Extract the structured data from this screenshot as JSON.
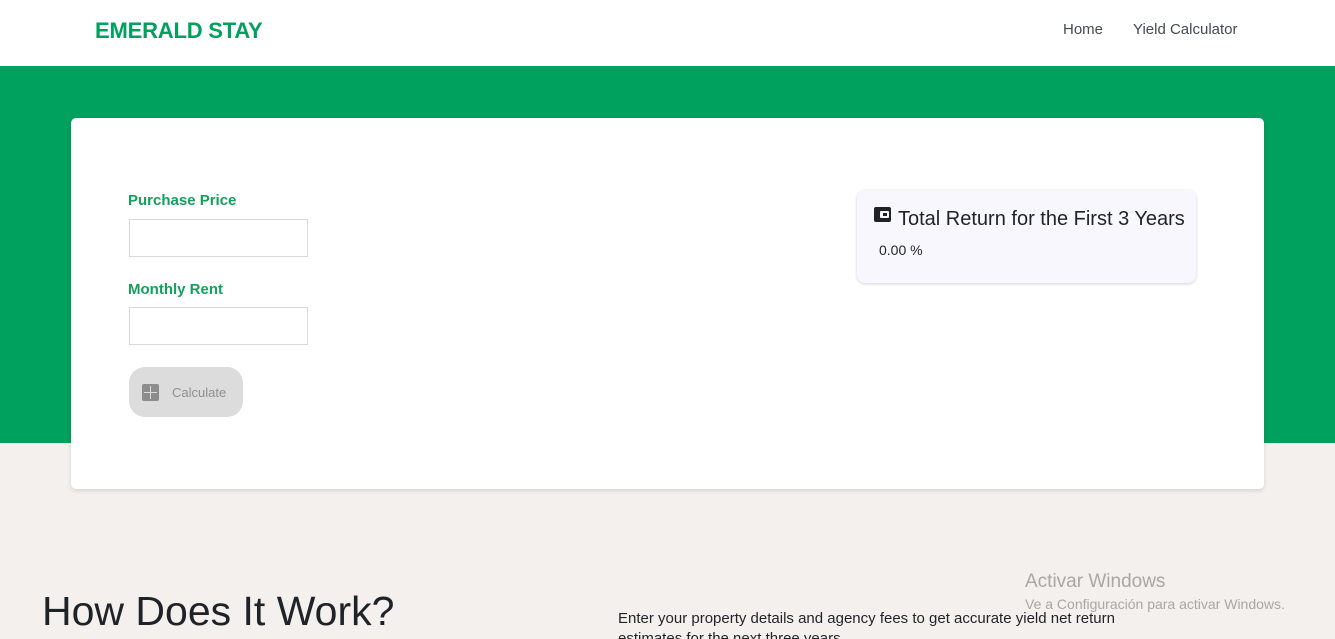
{
  "nav": {
    "brand": "EMERALD STAY",
    "links": [
      "Home",
      "Yield Calculator"
    ]
  },
  "form": {
    "purchase_price_label": "Purchase Price",
    "purchase_price_value": "",
    "monthly_rent_label": "Monthly Rent",
    "monthly_rent_value": "",
    "calculate_label": "Calculate"
  },
  "result": {
    "icon": "wallet-icon",
    "title": "Total Return for the First 3 Years",
    "value": "0.00 %"
  },
  "info": {
    "heading": "How Does It Work?",
    "text": "Enter your property details and agency fees to get accurate yield net return estimates for the next three years."
  },
  "watermark": {
    "title": "Activar Windows",
    "subtitle": "Ve a Configuración para activar Windows."
  },
  "colors": {
    "brand_green": "#00a05e",
    "label_green": "#13a05a",
    "page_background": "#f3f0ed",
    "card_background": "#ffffff",
    "button_disabled": "#dcdcdc"
  }
}
